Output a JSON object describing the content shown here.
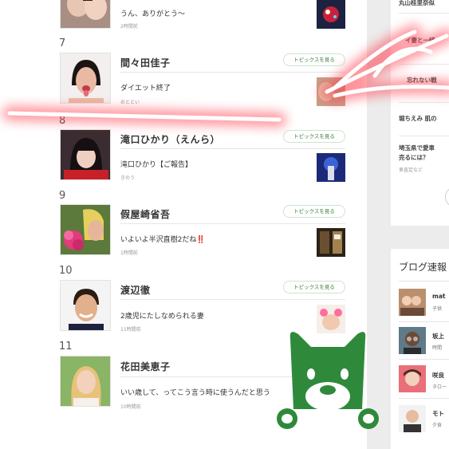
{
  "topics_button_label": "トピックスを見る",
  "rankings": [
    {
      "rank": "",
      "name": "",
      "post_title": "うん、ありがとう〜",
      "post_time": "2時間前"
    },
    {
      "rank": "7",
      "name": "間々田佳子",
      "post_title": "ダイエット終了",
      "post_time": "おととい"
    },
    {
      "rank": "8",
      "name": "滝口ひかり（えんら）",
      "post_title": "滝口ひかり【ご報告】",
      "post_time": "きのう"
    },
    {
      "rank": "9",
      "name": "假屋崎省吾",
      "post_title": "いよいよ半沢直樹2だね‼️",
      "post_time": "1時間前"
    },
    {
      "rank": "10",
      "name": "渡辺徹",
      "post_title": "2歳児にたしなめられる妻",
      "post_time": "11時間前"
    },
    {
      "rank": "11",
      "name": "花田美恵子",
      "post_title": "いい歳して、ってこう言う時に使うんだと思う",
      "post_time": "10時間前"
    }
  ],
  "sidebar": {
    "news": [
      {
        "title": "丸山桂里奈似"
      },
      {
        "title": "イ妻と一緒"
      },
      {
        "title": "忘れない戦"
      },
      {
        "title": "堀ちえみ 肌の"
      },
      {
        "title": "埼玉県で愛車",
        "title2": "売るには？",
        "sub": "車査定など"
      }
    ],
    "blog_heading": "ブログ速報",
    "blogs": [
      {
        "name": "mat",
        "sub": "子供"
      },
      {
        "name": "坂上",
        "sub": "時間"
      },
      {
        "name": "咲良",
        "sub": "タロー"
      },
      {
        "name": "モト",
        "sub": "夕食"
      }
    ]
  },
  "colors": {
    "accent_green": "#2e8a3a",
    "button_text": "#3a7d3a",
    "highlight": "#ff4a5a"
  }
}
